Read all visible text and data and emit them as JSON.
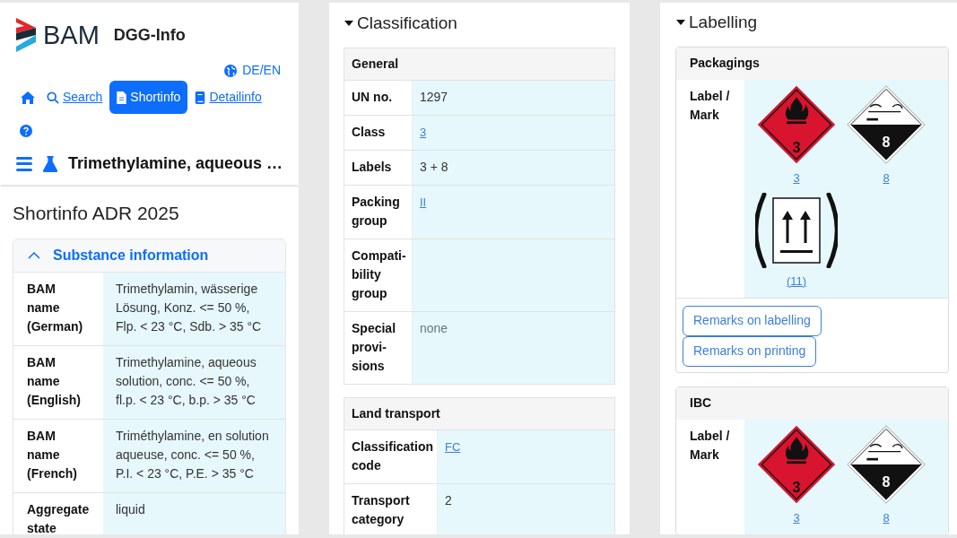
{
  "brand": {
    "logo_text": "BAM",
    "app_name": "DGG-Info"
  },
  "language": "DE/EN",
  "nav": [
    {
      "kind": "home",
      "selected": false
    },
    {
      "kind": "link",
      "label": "Search",
      "selected": false
    },
    {
      "kind": "link",
      "label": "Shortinfo",
      "selected": true
    },
    {
      "kind": "link",
      "label": "Detailinfo",
      "selected": false
    },
    {
      "kind": "help",
      "selected": false
    }
  ],
  "substance_title": "Trimethylamine, aqueous …",
  "page_heading": "Shortinfo ADR 2025",
  "substance_info": {
    "title": "Substance information",
    "expanded": true,
    "rows": [
      {
        "label": "BAM name (German)",
        "value": "Trimethylamin, wässerige Lösung, Konz. <= 50 %, Flp. < 23 °C, Sdb. > 35 °C"
      },
      {
        "label": "BAM name (English)",
        "value": "Trimethylamine, aqueous solution, conc. <= 50 %, fl.p. < 23 °C, b.p. > 35 °C"
      },
      {
        "label": "BAM name (French)",
        "value": "Triméthylamine, en solution aqueuse, conc. <= 50 %, P.I. < 23 °C, P.E. > 35 °C"
      },
      {
        "label": "Aggregate state",
        "value": "liquid"
      }
    ]
  },
  "classification": {
    "title": "Classification",
    "expanded": true,
    "tables": [
      {
        "title": "General",
        "rows": [
          {
            "label": "UN no.",
            "value": "1297",
            "kind": "text"
          },
          {
            "label": "Class",
            "value": "3",
            "kind": "link"
          },
          {
            "label": "Labels",
            "value": "3 + 8",
            "kind": "text"
          },
          {
            "label": "Packing group",
            "value": "II",
            "kind": "link"
          },
          {
            "label": "Compati-bility group"
          },
          {
            "label": "Special provi-sions",
            "value": "none",
            "kind": "muted"
          }
        ]
      },
      {
        "title": "Land transport",
        "rows": [
          {
            "label": "Classification code",
            "value": "FC",
            "kind": "link"
          },
          {
            "label": "Transport category",
            "value": "2",
            "kind": "text"
          }
        ]
      }
    ]
  },
  "labelling": {
    "title": "Labelling",
    "expanded": true,
    "cards": [
      {
        "title": "Packagings",
        "label": "Label / Mark",
        "labels": [
          {
            "kind": "flammable",
            "number": "3",
            "caption": "3"
          },
          {
            "kind": "corrosive",
            "number": "8",
            "caption": "8"
          },
          {
            "kind": "orientation",
            "caption": "(11)"
          }
        ],
        "buttons": [
          "Remarks on labelling",
          "Remarks on printing"
        ]
      },
      {
        "title": "IBC",
        "label": "Label / Mark",
        "labels": [
          {
            "kind": "flammable",
            "number": "3",
            "caption": "3"
          },
          {
            "kind": "corrosive",
            "number": "8",
            "caption": "8"
          }
        ]
      }
    ]
  }
}
